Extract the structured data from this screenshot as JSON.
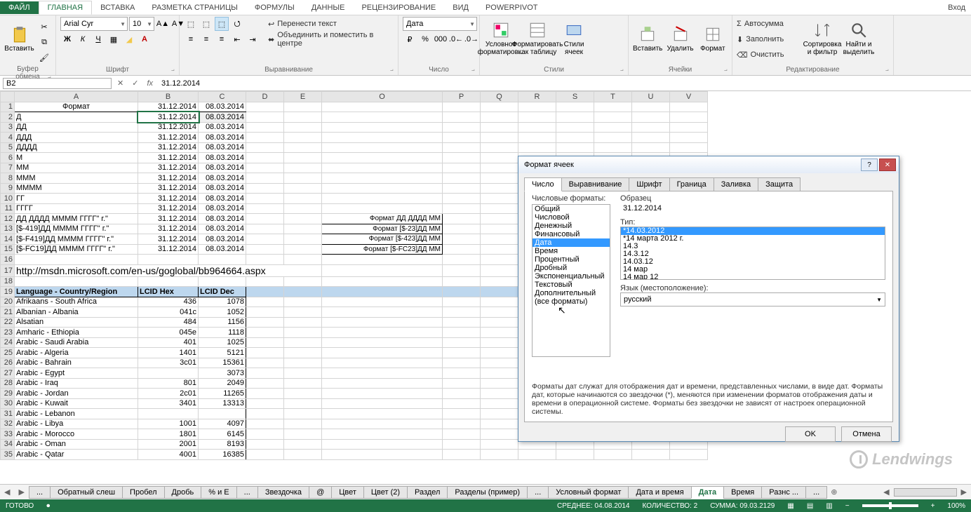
{
  "ribbon": {
    "tabs": [
      "ФАЙЛ",
      "ГЛАВНАЯ",
      "ВСТАВКА",
      "РАЗМЕТКА СТРАНИЦЫ",
      "ФОРМУЛЫ",
      "ДАННЫЕ",
      "РЕЦЕНЗИРОВАНИЕ",
      "ВИД",
      "POWERPIVOT"
    ],
    "login": "Вход",
    "groups": {
      "clipboard": {
        "label": "Буфер обмена",
        "paste": "Вставить"
      },
      "font": {
        "label": "Шрифт",
        "name": "Arial Cyr",
        "size": "10"
      },
      "align": {
        "label": "Выравнивание",
        "wrap": "Перенести текст",
        "merge": "Объединить и поместить в центре"
      },
      "number": {
        "label": "Число",
        "format": "Дата"
      },
      "styles": {
        "label": "Стили",
        "cond": "Условное форматиров...",
        "table": "Форматировать как таблицу",
        "cell": "Стили ячеек"
      },
      "cells": {
        "label": "Ячейки",
        "ins": "Вставить",
        "del": "Удалить",
        "fmt": "Формат"
      },
      "editing": {
        "label": "Редактирование",
        "sum": "Автосумма",
        "fill": "Заполнить",
        "clear": "Очистить",
        "sort": "Сортировка и фильтр",
        "find": "Найти и выделить"
      }
    }
  },
  "namebox": "B2",
  "formula": "31.12.2014",
  "columns": [
    "A",
    "B",
    "C",
    "D",
    "E",
    "O",
    "P",
    "Q",
    "R",
    "S",
    "T",
    "U",
    "V"
  ],
  "cellA1": "Формат",
  "rows_top": [
    {
      "r": 1,
      "a": "Формат",
      "b": "31.12.2014",
      "c": "08.03.2014"
    },
    {
      "r": 2,
      "a": "Д",
      "b": "31.12.2014",
      "c": "08.03.2014"
    },
    {
      "r": 3,
      "a": "ДД",
      "b": "31.12.2014",
      "c": "08.03.2014"
    },
    {
      "r": 4,
      "a": "ДДД",
      "b": "31.12.2014",
      "c": "08.03.2014"
    },
    {
      "r": 5,
      "a": "ДДДД",
      "b": "31.12.2014",
      "c": "08.03.2014"
    },
    {
      "r": 6,
      "a": "М",
      "b": "31.12.2014",
      "c": "08.03.2014"
    },
    {
      "r": 7,
      "a": "ММ",
      "b": "31.12.2014",
      "c": "08.03.2014"
    },
    {
      "r": 8,
      "a": "МММ",
      "b": "31.12.2014",
      "c": "08.03.2014"
    },
    {
      "r": 9,
      "a": "ММММ",
      "b": "31.12.2014",
      "c": "08.03.2014"
    },
    {
      "r": 10,
      "a": "ГГ",
      "b": "31.12.2014",
      "c": "08.03.2014"
    },
    {
      "r": 11,
      "a": "ГГГГ",
      "b": "31.12.2014",
      "c": "08.03.2014"
    },
    {
      "r": 12,
      "a": "ДД ДДДД  ММММ ГГГГ\" г.\"",
      "b": "31.12.2014",
      "c": "08.03.2014"
    },
    {
      "r": 13,
      "a": "[$-419]ДД  ММММ ГГГГ\" г.\"",
      "b": "31.12.2014",
      "c": "08.03.2014"
    },
    {
      "r": 14,
      "a": "[$-F419]ДД  ММММ ГГГГ\" г.\"",
      "b": "31.12.2014",
      "c": "08.03.2014"
    },
    {
      "r": 15,
      "a": "[$-FC19]ДД  ММММ ГГГГ\" г.\"",
      "b": "31.12.2014",
      "c": "08.03.2014"
    }
  ],
  "ocol": [
    {
      "r": 12,
      "o": "Формат ДД ДДДД  ММ"
    },
    {
      "r": 13,
      "o": "Формат [$-23]ДД  ММ"
    },
    {
      "r": 14,
      "o": "Формат [$-423]ДД  ММ"
    },
    {
      "r": 15,
      "o": "Формат [$-FC23]ДД  ММ"
    }
  ],
  "url_row": {
    "r": 17,
    "text": "http://msdn.microsoft.com/en-us/goglobal/bb964664.aspx"
  },
  "header_row": {
    "r": 19,
    "a": "Language - Country/Region",
    "b": "LCID Hex",
    "c": "LCID Dec"
  },
  "lang_rows": [
    {
      "r": 20,
      "a": "Afrikaans - South Africa",
      "b": "436",
      "c": "1078"
    },
    {
      "r": 21,
      "a": "Albanian - Albania",
      "b": "041c",
      "c": "1052"
    },
    {
      "r": 22,
      "a": "Alsatian",
      "b": "484",
      "c": "1156"
    },
    {
      "r": 23,
      "a": "Amharic - Ethiopia",
      "b": "045e",
      "c": "1118"
    },
    {
      "r": 24,
      "a": "Arabic - Saudi Arabia",
      "b": "401",
      "c": "1025"
    },
    {
      "r": 25,
      "a": "Arabic - Algeria",
      "b": "1401",
      "c": "5121"
    },
    {
      "r": 26,
      "a": "Arabic - Bahrain",
      "b": "3c01",
      "c": "15361"
    },
    {
      "r": 27,
      "a": "Arabic - Egypt",
      "b": "",
      "c": "3073"
    },
    {
      "r": 28,
      "a": "Arabic - Iraq",
      "b": "801",
      "c": "2049"
    },
    {
      "r": 29,
      "a": "Arabic - Jordan",
      "b": "2c01",
      "c": "11265"
    },
    {
      "r": 30,
      "a": "Arabic - Kuwait",
      "b": "3401",
      "c": "13313"
    },
    {
      "r": 31,
      "a": "Arabic - Lebanon",
      "b": "",
      "c": ""
    },
    {
      "r": 32,
      "a": "Arabic - Libya",
      "b": "1001",
      "c": "4097"
    },
    {
      "r": 33,
      "a": "Arabic - Morocco",
      "b": "1801",
      "c": "6145"
    },
    {
      "r": 34,
      "a": "Arabic - Oman",
      "b": "2001",
      "c": "8193"
    },
    {
      "r": 35,
      "a": "Arabic - Qatar",
      "b": "4001",
      "c": "16385"
    }
  ],
  "sheet_tabs": [
    "...",
    "Обратный слеш",
    "Пробел",
    "Дробь",
    "% и E",
    "...",
    "Звездочка",
    "@",
    "Цвет",
    "Цвет (2)",
    "Раздел",
    "Разделы (пример)",
    "...",
    "Условный формат",
    "Дата и время",
    "Дата",
    "Время",
    "Разнс ...",
    "..."
  ],
  "active_sheet": "Дата",
  "status": {
    "ready": "ГОТОВО",
    "avg": "СРЕДНЕЕ: 04.08.2014",
    "count": "КОЛИЧЕСТВО: 2",
    "sum": "СУММА: 09.03.2129",
    "zoom": "100%"
  },
  "dialog": {
    "title": "Формат ячеек",
    "tabs": [
      "Число",
      "Выравнивание",
      "Шрифт",
      "Граница",
      "Заливка",
      "Защита"
    ],
    "cat_label": "Числовые форматы:",
    "categories": [
      "Общий",
      "Числовой",
      "Денежный",
      "Финансовый",
      "Дата",
      "Время",
      "Процентный",
      "Дробный",
      "Экспоненциальный",
      "Текстовый",
      "Дополнительный",
      "(все форматы)"
    ],
    "sample_label": "Образец",
    "sample_value": "31.12.2014",
    "type_label": "Тип:",
    "types": [
      "*14.03.2012",
      "*14 марта 2012 г.",
      "14.3",
      "14.3.12",
      "14.03.12",
      "14 мар",
      "14 мар 12"
    ],
    "locale_label": "Язык (местоположение):",
    "locale_value": "русский",
    "description": "Форматы дат служат для отображения дат и времени, представленных числами, в виде дат. Форматы дат, которые начинаются со звездочки (*), меняются при изменении форматов отображения даты и времени в операционной системе. Форматы без звездочки не зависят от настроек операционной системы.",
    "ok": "OK",
    "cancel": "Отмена"
  },
  "watermark": "Lendwings"
}
